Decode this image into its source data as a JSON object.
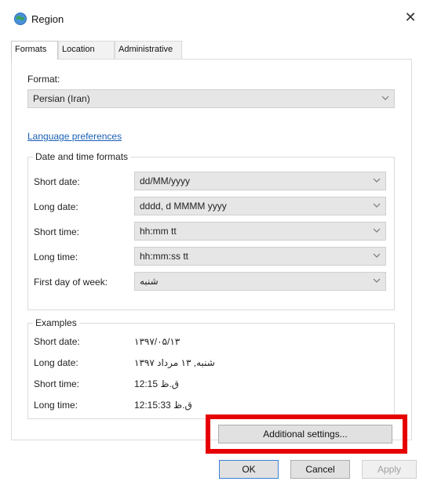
{
  "window": {
    "title": "Region",
    "close_glyph": "✕"
  },
  "tabs": [
    {
      "label": "Formats",
      "active": true
    },
    {
      "label": "Location",
      "active": false
    },
    {
      "label": "Administrative",
      "active": false
    }
  ],
  "format": {
    "label": "Format:",
    "value": "Persian (Iran)"
  },
  "language_link": "Language preferences",
  "date_time_formats": {
    "legend": "Date and time formats",
    "rows": [
      {
        "label": "Short date:",
        "value": "dd/MM/yyyy"
      },
      {
        "label": "Long date:",
        "value": "dddd, d MMMM yyyy"
      },
      {
        "label": "Short time:",
        "value": "hh:mm tt"
      },
      {
        "label": "Long time:",
        "value": "hh:mm:ss tt"
      },
      {
        "label": "First day of week:",
        "value": "شنبه"
      }
    ]
  },
  "examples": {
    "legend": "Examples",
    "rows": [
      {
        "label": "Short date:",
        "value": "۱۳۹۷/۰۵/۱۳"
      },
      {
        "label": "Long date:",
        "value": "شنبه, ۱۳ مرداد ۱۳۹۷"
      },
      {
        "label": "Short time:",
        "value": "12:15 ق.ظ"
      },
      {
        "label": "Long time:",
        "value": "12:15:33 ق.ظ"
      }
    ]
  },
  "buttons": {
    "additional_settings": "Additional settings...",
    "ok": "OK",
    "cancel": "Cancel",
    "apply": "Apply"
  },
  "colors": {
    "highlight": "#e60000",
    "link": "#1a5fb4",
    "primary_border": "#3c7fd6"
  },
  "icons": {
    "window": "globe-icon",
    "dropdown": "chevron-down-icon"
  }
}
